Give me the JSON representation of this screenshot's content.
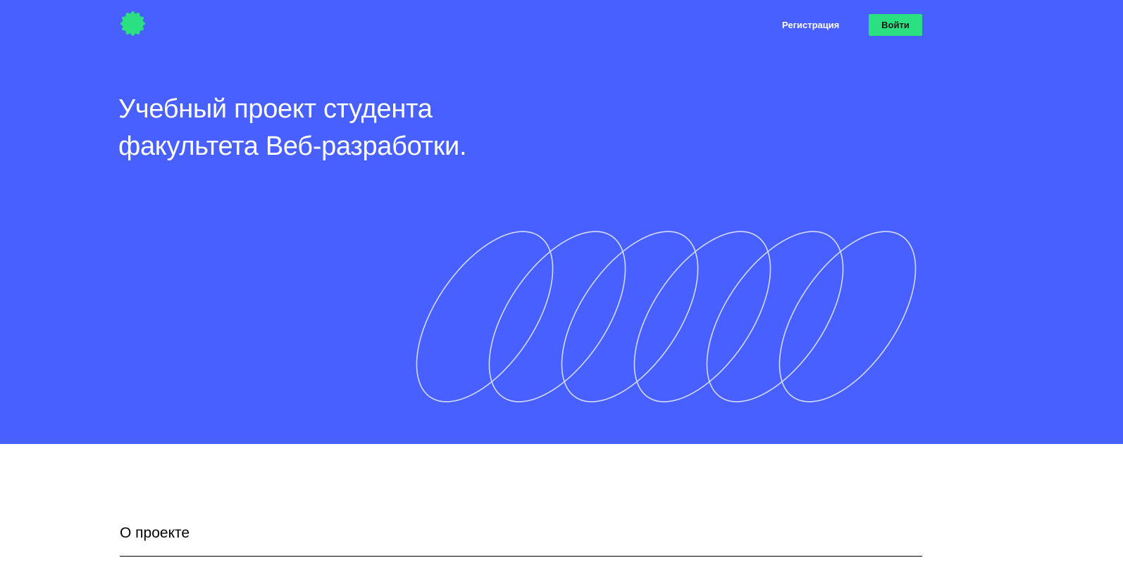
{
  "colors": {
    "hero_background": "#4760ff",
    "accent_green": "#2be080",
    "loop_stroke": "#d2d9ff",
    "text_on_hero": "#ffffff",
    "page_background": "#ffffff"
  },
  "header": {
    "logo_icon": "green-scalloped-badge-icon",
    "register_label": "Регистрация",
    "login_label": "Войти"
  },
  "hero": {
    "title_line_1": "Учебный проект студента",
    "title_line_2": "факультета Веб-разработки.",
    "decoration_icon": "cursive-loops-decoration"
  },
  "about": {
    "title": "О проекте"
  }
}
